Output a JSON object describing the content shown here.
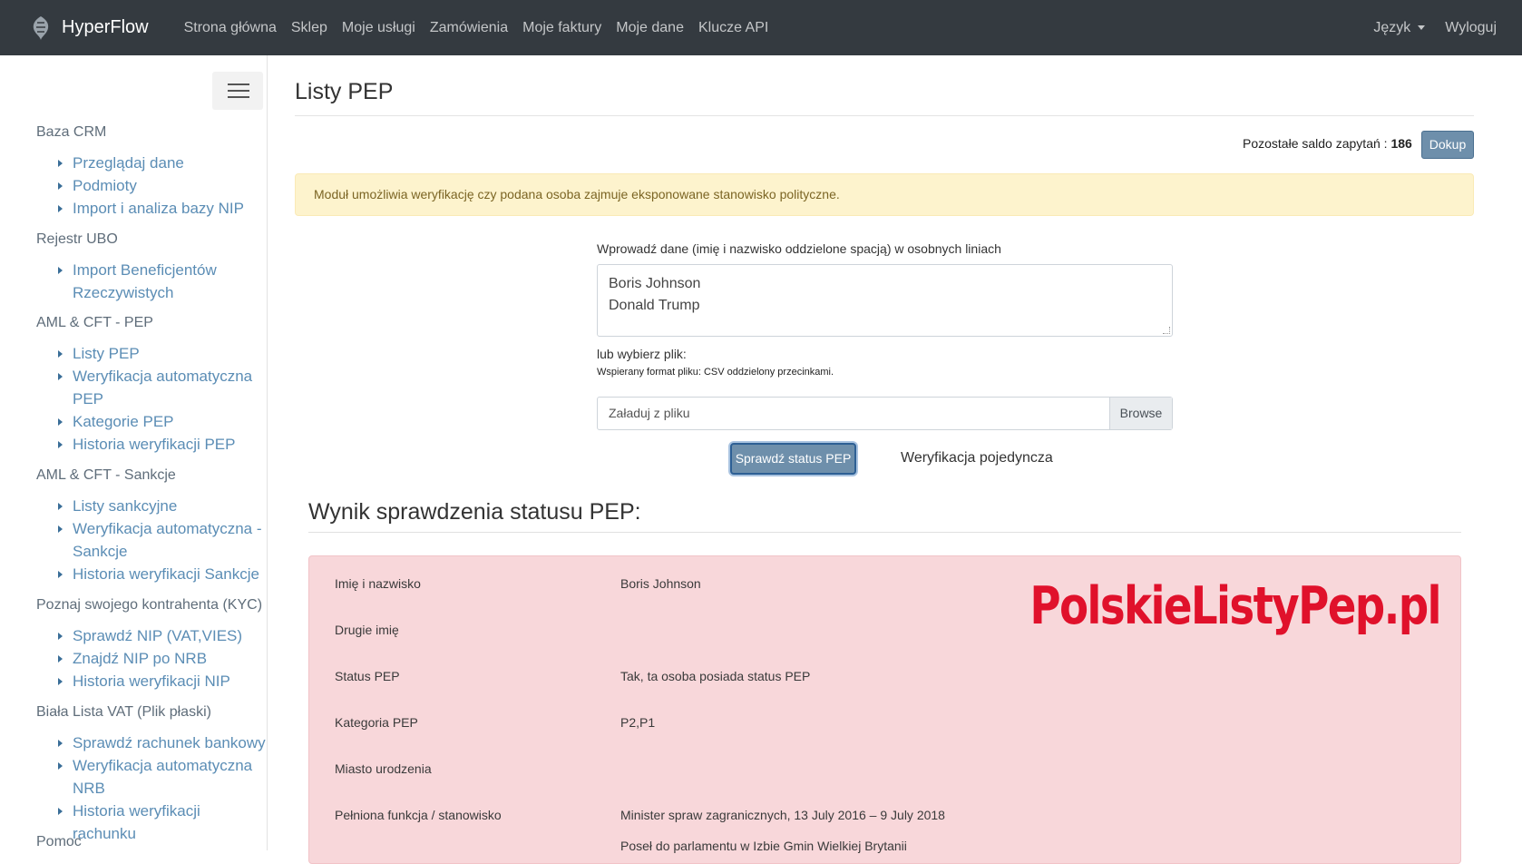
{
  "navbar": {
    "brand": "HyperFlow",
    "links": [
      "Strona główna",
      "Sklep",
      "Moje usługi",
      "Zamówienia",
      "Moje faktury",
      "Moje dane",
      "Klucze API"
    ],
    "language": "Język",
    "logout": "Wyloguj"
  },
  "sidebar": {
    "sections": [
      {
        "title": "Baza CRM",
        "items": [
          "Przeglądaj dane",
          "Podmioty",
          "Import i analiza bazy NIP"
        ]
      },
      {
        "title": "Rejestr UBO",
        "items": [
          "Import Beneficjentów Rzeczywistych"
        ]
      },
      {
        "title": "AML & CFT - PEP",
        "items": [
          "Listy PEP",
          "Weryfikacja automatyczna PEP",
          "Kategorie PEP",
          "Historia weryfikacji PEP"
        ]
      },
      {
        "title": "AML & CFT - Sankcje",
        "items": [
          "Listy sankcyjne",
          "Weryfikacja automatyczna - Sankcje",
          "Historia weryfikacji Sankcje"
        ]
      },
      {
        "title": "Poznaj swojego kontrahenta (KYC)",
        "items": [
          "Sprawdź NIP (VAT,VIES)",
          "Znajdź NIP po NRB",
          "Historia weryfikacji NIP"
        ]
      },
      {
        "title": "Biała Lista VAT (Plik płaski)",
        "items": [
          "Sprawdź rachunek bankowy",
          "Weryfikacja automatyczna NRB",
          "Historia weryfikacji rachunku"
        ]
      },
      {
        "title": "Pomoc",
        "items": []
      }
    ]
  },
  "main": {
    "title": "Listy PEP",
    "saldo_label": "Pozostałe saldo zapytań :",
    "saldo_value": "186",
    "dokup": "Dokup",
    "alert": "Moduł umożliwia weryfikację czy podana osoba zajmuje eksponowane stanowisko polityczne.",
    "input_label": "Wprowadź dane (imię i nazwisko oddzielone spacją) w osobnych liniach",
    "textarea_lines": [
      "Boris Johnson",
      "Donald Trump"
    ],
    "or_file": "lub wybierz plik:",
    "format_note": "Wspierany format pliku: CSV oddzielony przecinkami.",
    "file_placeholder": "Załaduj z pliku",
    "browse": "Browse",
    "check_button": "Sprawdź status PEP",
    "single_verification": "Weryfikacja pojedyncza",
    "result_title": "Wynik sprawdzenia statusu PEP:",
    "watermark": "PolskieListyPep.pl",
    "results": [
      {
        "label": "Imię i nazwisko",
        "value": "Boris Johnson"
      },
      {
        "label": "Drugie imię",
        "value": ""
      },
      {
        "label": "Status PEP",
        "value": "Tak, ta osoba posiada status PEP"
      },
      {
        "label": "Kategoria PEP",
        "value": "P2,P1"
      },
      {
        "label": "Miasto urodzenia",
        "value": ""
      },
      {
        "label": "Pełniona funkcja / stanowisko",
        "value": "Minister spraw zagranicznych, 13 July 2016 – 9 July 2018"
      }
    ],
    "results_extra_line": "Poseł do parlamentu w Izbie Gmin Wielkiej Brytanii"
  },
  "colors": {
    "navbar_bg": "#343a40",
    "sidebar_link": "#5b8db5",
    "alert_bg": "#fdf3cd",
    "result_bg": "#f8d7da",
    "watermark": "#e0112b",
    "button_bg": "#6e8fab"
  }
}
